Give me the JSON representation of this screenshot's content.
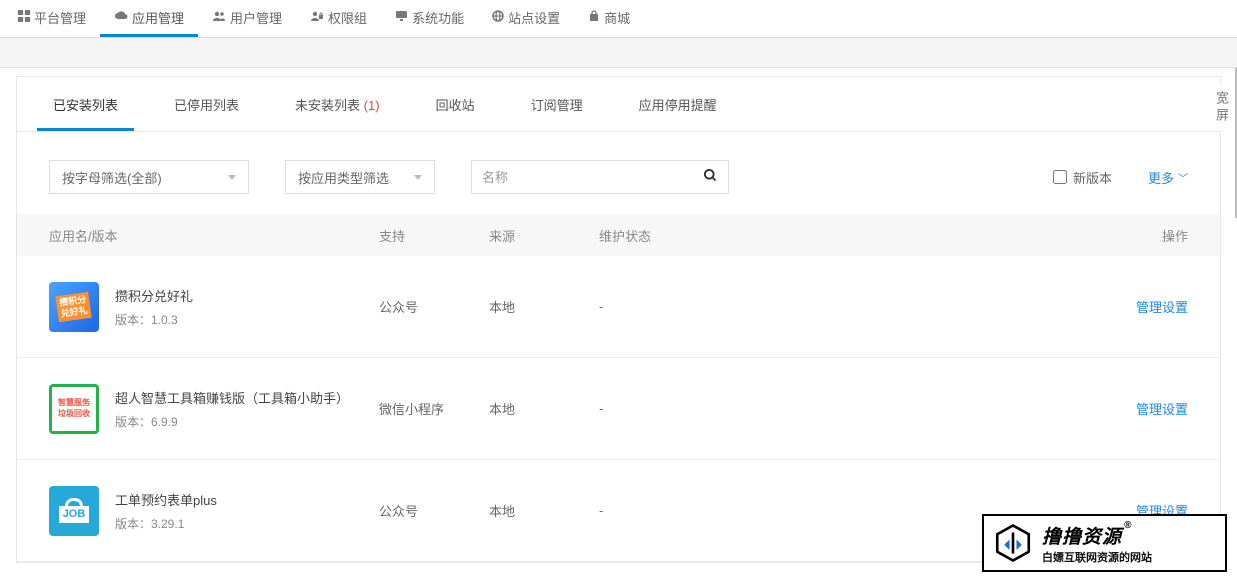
{
  "topNav": [
    {
      "label": "平台管理",
      "icon": "grid"
    },
    {
      "label": "应用管理",
      "icon": "cloud",
      "active": true
    },
    {
      "label": "用户管理",
      "icon": "users"
    },
    {
      "label": "权限组",
      "icon": "lock"
    },
    {
      "label": "系统功能",
      "icon": "monitor"
    },
    {
      "label": "站点设置",
      "icon": "globe"
    },
    {
      "label": "商城",
      "icon": "bag"
    }
  ],
  "tabs": [
    {
      "label": "已安装列表",
      "active": true
    },
    {
      "label": "已停用列表"
    },
    {
      "label": "未安装列表",
      "count": "(1)"
    },
    {
      "label": "回收站"
    },
    {
      "label": "订阅管理"
    },
    {
      "label": "应用停用提醒"
    }
  ],
  "filters": {
    "letterFilter": "按字母筛选(全部)",
    "typeFilter": "按应用类型筛选",
    "searchPlaceholder": "名称",
    "newVersionLabel": "新版本",
    "moreLabel": "更多"
  },
  "columns": {
    "app": "应用名/版本",
    "support": "支持",
    "source": "来源",
    "status": "维护状态",
    "action": "操作"
  },
  "versionPrefix": "版本：",
  "rows": [
    {
      "name": "攒积分兑好礼",
      "version": "1.0.3",
      "support": "公众号",
      "source": "本地",
      "status": "-",
      "action": "管理设置",
      "iconClass": "icon1",
      "iconText": "攒积分兑好礼"
    },
    {
      "name": "超人智慧工具箱赚钱版（工具箱小助手）",
      "version": "6.9.9",
      "support": "微信小程序",
      "source": "本地",
      "status": "-",
      "action": "管理设置",
      "iconClass": "icon2",
      "iconText": "智慧服务 垃圾回收"
    },
    {
      "name": "工单预约表单plus",
      "version": "3.29.1",
      "support": "公众号",
      "source": "本地",
      "status": "-",
      "action": "管理设置",
      "iconClass": "icon3",
      "iconText": "JOB"
    }
  ],
  "wideToggle": "宽屏",
  "watermark": {
    "title": "撸撸资源",
    "sub": "白嫖互联网资源的网站",
    "r": "®"
  }
}
